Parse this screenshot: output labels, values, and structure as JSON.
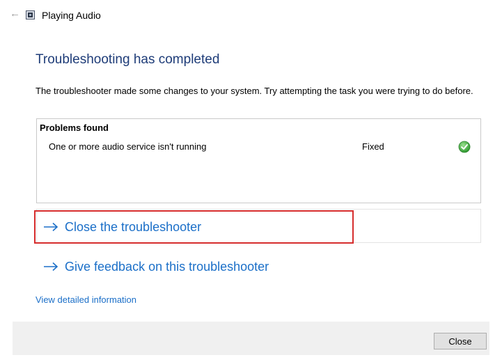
{
  "window": {
    "title": "Playing Audio",
    "back_icon": "back-arrow-icon",
    "app_icon": "troubleshooter-icon"
  },
  "main": {
    "heading": "Troubleshooting has completed",
    "description": "The troubleshooter made some changes to your system. Try attempting the task you were trying to do before."
  },
  "problems": {
    "header": "Problems found",
    "items": [
      {
        "description": "One or more audio service isn't running",
        "status": "Fixed",
        "status_icon": "checkmark-icon"
      }
    ]
  },
  "links": {
    "close_troubleshooter": "Close the troubleshooter",
    "give_feedback": "Give feedback on this troubleshooter",
    "view_details": "View detailed information"
  },
  "footer": {
    "close_label": "Close"
  },
  "colors": {
    "heading": "#1e3c78",
    "link": "#1b6fc8",
    "highlight_border": "#d62d2d",
    "check_green": "#3aa53a"
  }
}
